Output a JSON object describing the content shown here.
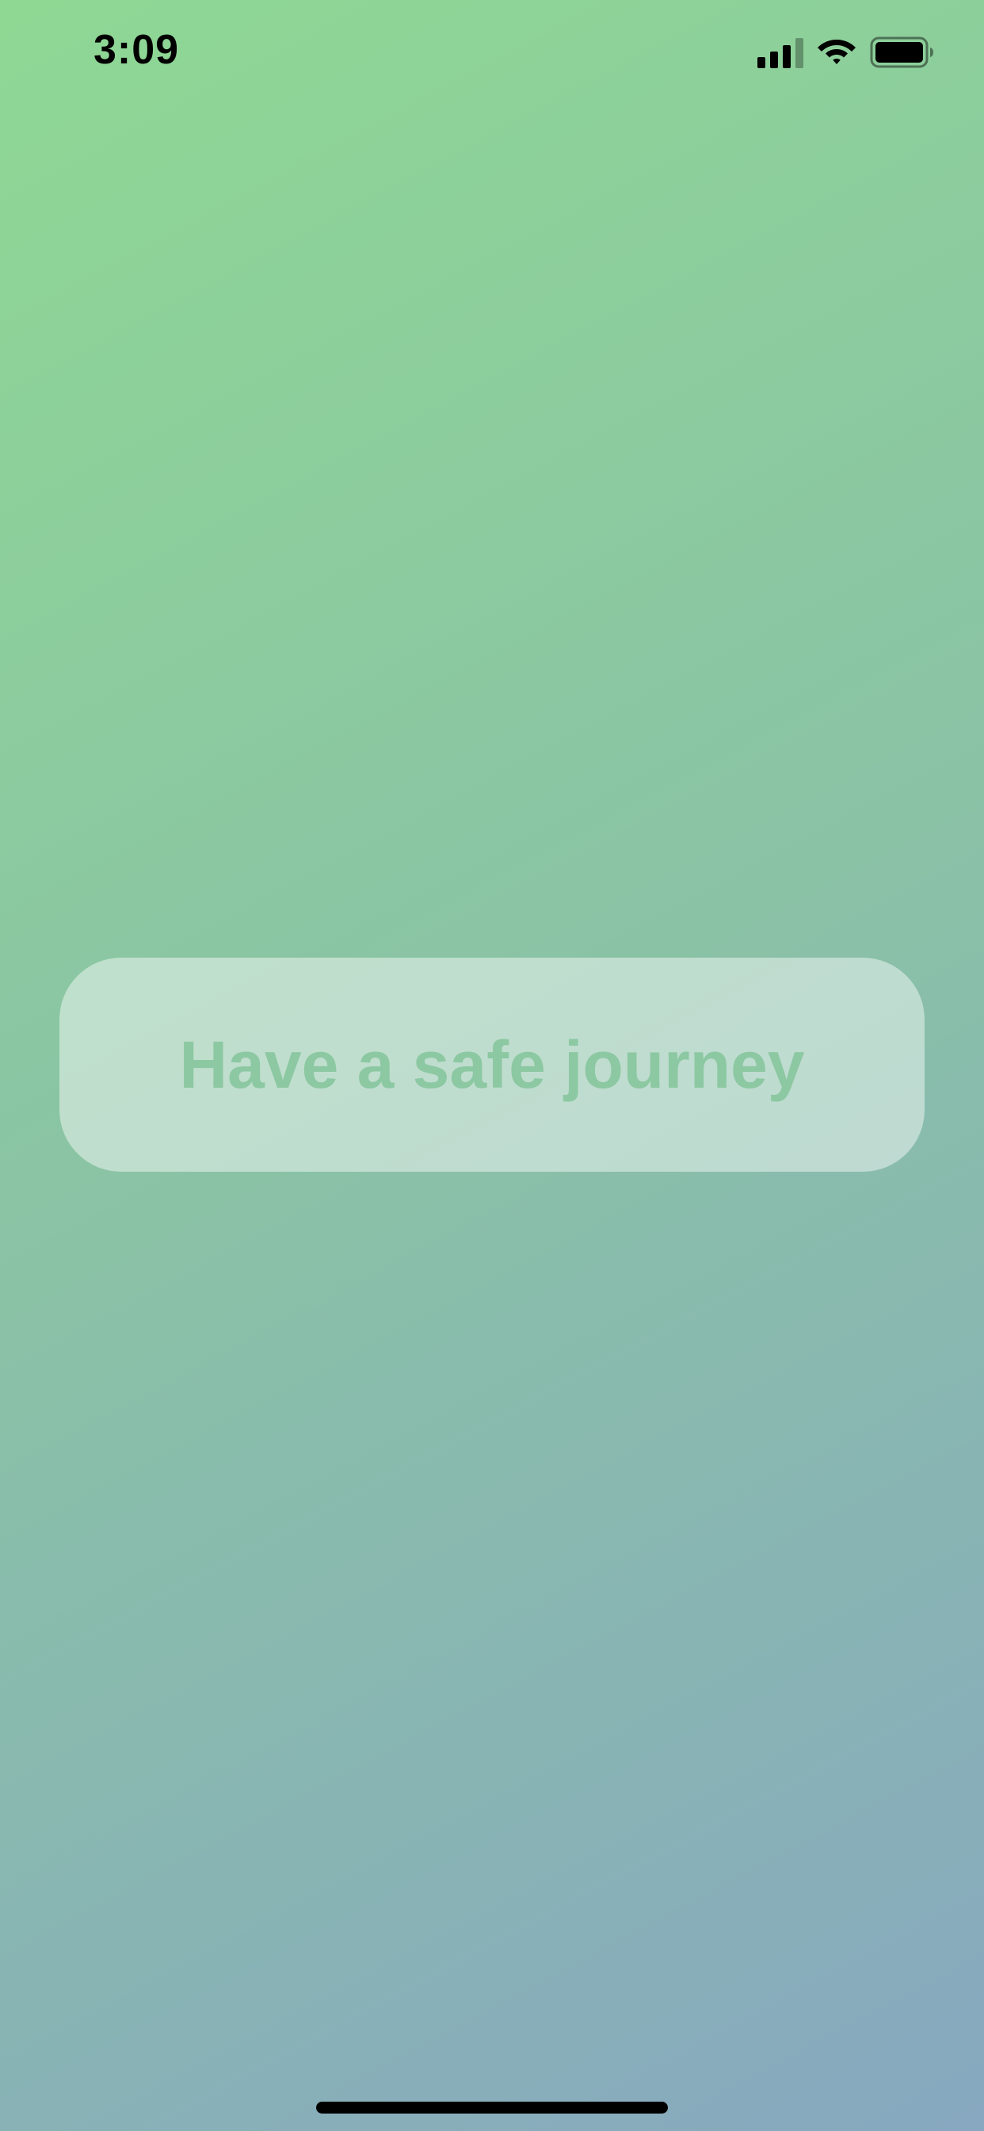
{
  "status_bar": {
    "time": "3:09",
    "icons": [
      "cellular-signal-icon",
      "wifi-icon",
      "battery-icon"
    ]
  },
  "message": {
    "text": "Have a safe journey"
  },
  "colors": {
    "gradient_start": "#8fd894",
    "gradient_mid": "#8ac4a4",
    "gradient_end": "#87a8c0",
    "message_text": "#8cc8a2"
  }
}
